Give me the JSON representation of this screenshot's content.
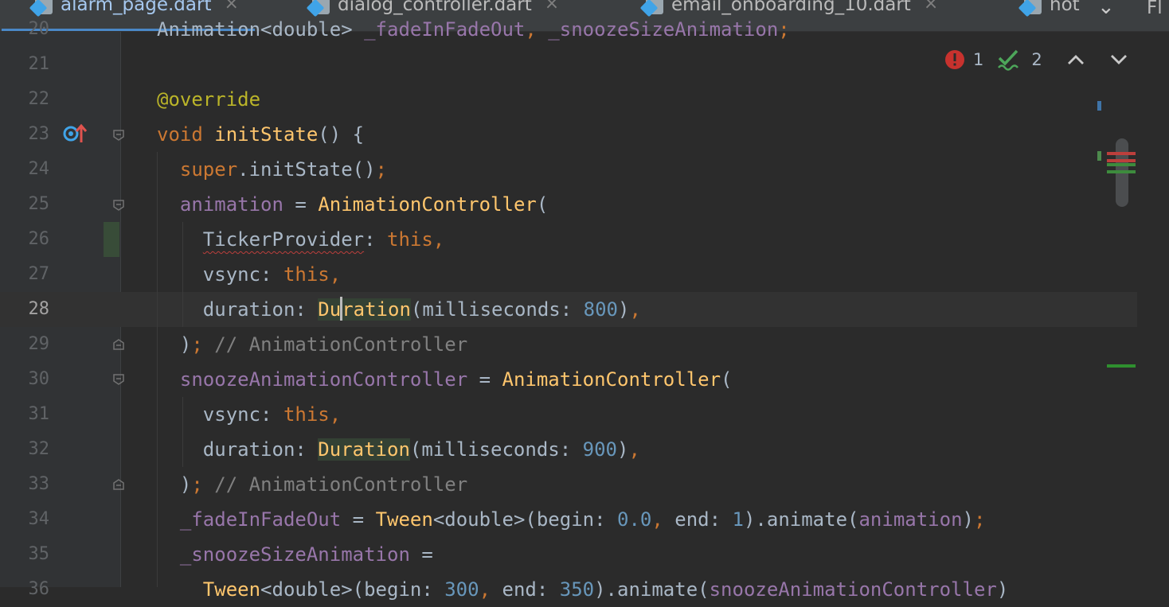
{
  "tabs": [
    {
      "label": "alarm_page.dart",
      "active": true,
      "close": "×"
    },
    {
      "label": "dialog_controller.dart",
      "active": false,
      "close": "×"
    },
    {
      "label": "email_onboarding_10.dart",
      "active": false,
      "close": "×"
    },
    {
      "label": "hot",
      "active": false,
      "close": ""
    }
  ],
  "tabbar": {
    "dropdown": "⌄",
    "right_label": "Fl"
  },
  "inspections": {
    "errors": "1",
    "warnings": "2"
  },
  "icons": {
    "file": "dart-file-icon",
    "error": "error-icon",
    "warning": "double-check-warning-icon",
    "prev": "chevron-up-icon",
    "next": "chevron-down-icon",
    "override": "override-marker-icon",
    "fold": "fold-icon"
  },
  "lines": [
    {
      "num": "20",
      "text": "Animation<double> _fadeInFadeOut, _snoozeSizeAnimation;"
    },
    {
      "num": "21",
      "text": ""
    },
    {
      "num": "22",
      "text": "@override"
    },
    {
      "num": "23",
      "text": "void initState() {"
    },
    {
      "num": "24",
      "text": "super.initState();"
    },
    {
      "num": "25",
      "text": "animation = AnimationController("
    },
    {
      "num": "26",
      "text": "TickerProvider: this,"
    },
    {
      "num": "27",
      "text": "vsync: this,"
    },
    {
      "num": "28",
      "text": "duration: Duration(milliseconds: 800),"
    },
    {
      "num": "29",
      "text": "); // AnimationController"
    },
    {
      "num": "30",
      "text": "snoozeAnimationController = AnimationController("
    },
    {
      "num": "31",
      "text": "vsync: this,"
    },
    {
      "num": "32",
      "text": "duration: Duration(milliseconds: 900),"
    },
    {
      "num": "33",
      "text": "); // AnimationController"
    },
    {
      "num": "34",
      "text": "_fadeInFadeOut = Tween<double>(begin: 0.0, end: 1).animate(animation);"
    },
    {
      "num": "35",
      "text": "_snoozeSizeAnimation ="
    },
    {
      "num": "36",
      "text": "Tween<double>(begin: 300, end: 350).animate(snoozeAnimationController)"
    }
  ],
  "colors": {
    "background": "#2b2b2b",
    "gutter": "#313335",
    "keyword": "#cc7832",
    "function": "#ffc66d",
    "field": "#9876aa",
    "number": "#6897bb",
    "comment": "#808080",
    "annotation": "#bbb529",
    "error": "#bc3f3c",
    "accent": "#4a88c7"
  }
}
